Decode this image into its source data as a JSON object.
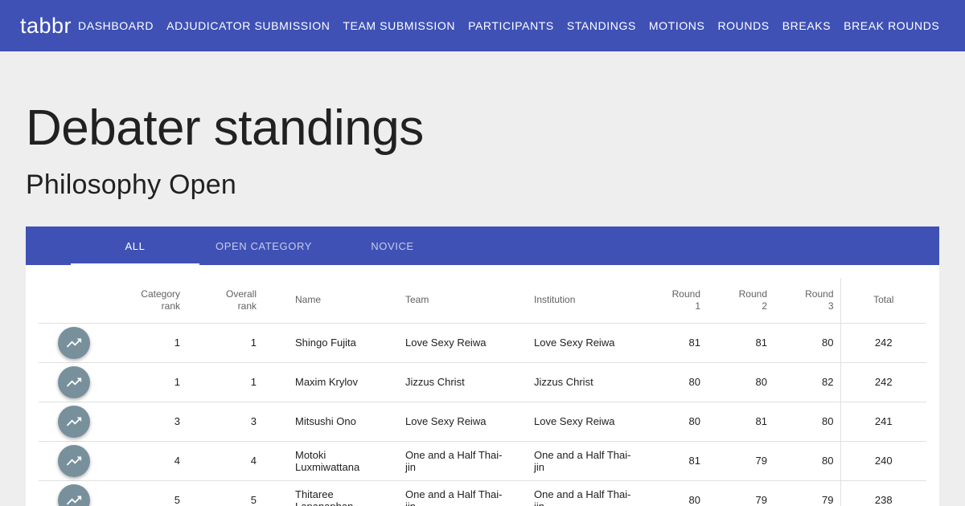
{
  "app": {
    "brand": "tabbr"
  },
  "nav": [
    {
      "label": "DASHBOARD",
      "name": "nav-dashboard"
    },
    {
      "label": "ADJUDICATOR SUBMISSION",
      "name": "nav-adjudicator-submission"
    },
    {
      "label": "TEAM SUBMISSION",
      "name": "nav-team-submission"
    },
    {
      "label": "PARTICIPANTS",
      "name": "nav-participants"
    },
    {
      "label": "STANDINGS",
      "name": "nav-standings"
    },
    {
      "label": "MOTIONS",
      "name": "nav-motions"
    },
    {
      "label": "ROUNDS",
      "name": "nav-rounds"
    },
    {
      "label": "BREAKS",
      "name": "nav-breaks"
    },
    {
      "label": "BREAK ROUNDS",
      "name": "nav-break-rounds"
    }
  ],
  "page": {
    "title": "Debater standings",
    "subtitle": "Philosophy Open"
  },
  "tabs": [
    {
      "label": "ALL",
      "active": true
    },
    {
      "label": "OPEN CATEGORY",
      "active": false
    },
    {
      "label": "NOVICE",
      "active": false
    }
  ],
  "table": {
    "headers": {
      "category_rank": [
        "Category",
        "rank"
      ],
      "overall_rank": [
        "Overall",
        "rank"
      ],
      "name": "Name",
      "team": "Team",
      "institution": "Institution",
      "round1": [
        "Round",
        "1"
      ],
      "round2": [
        "Round",
        "2"
      ],
      "round3": [
        "Round",
        "3"
      ],
      "total": "Total"
    },
    "rows": [
      {
        "category_rank": "1",
        "overall_rank": "1",
        "name": [
          "Shingo Fujita"
        ],
        "team": [
          "Love Sexy Reiwa"
        ],
        "institution": [
          "Love Sexy Reiwa"
        ],
        "r1": "81",
        "r2": "81",
        "r3": "80",
        "total": "242"
      },
      {
        "category_rank": "1",
        "overall_rank": "1",
        "name": [
          "Maxim Krylov"
        ],
        "team": [
          "Jizzus Christ"
        ],
        "institution": [
          "Jizzus Christ"
        ],
        "r1": "80",
        "r2": "80",
        "r3": "82",
        "total": "242"
      },
      {
        "category_rank": "3",
        "overall_rank": "3",
        "name": [
          "Mitsushi Ono"
        ],
        "team": [
          "Love Sexy Reiwa"
        ],
        "institution": [
          "Love Sexy Reiwa"
        ],
        "r1": "80",
        "r2": "81",
        "r3": "80",
        "total": "241"
      },
      {
        "category_rank": "4",
        "overall_rank": "4",
        "name": [
          "Motoki",
          "Luxmiwattana"
        ],
        "team": [
          "One and a Half Thai-",
          "jin"
        ],
        "institution": [
          "One and a Half Thai-",
          "jin"
        ],
        "r1": "81",
        "r2": "79",
        "r3": "80",
        "total": "240"
      },
      {
        "category_rank": "5",
        "overall_rank": "5",
        "name": [
          "Thitaree",
          "Lapanaphan"
        ],
        "team": [
          "One and a Half Thai-",
          "jin"
        ],
        "institution": [
          "One and a Half Thai-",
          "jin"
        ],
        "r1": "80",
        "r2": "79",
        "r3": "79",
        "total": "238"
      }
    ],
    "row_button_icon": "trending-up-icon"
  },
  "colors": {
    "primary": "#3f51b5",
    "background": "#eeeeee",
    "fab": "#78909c"
  }
}
